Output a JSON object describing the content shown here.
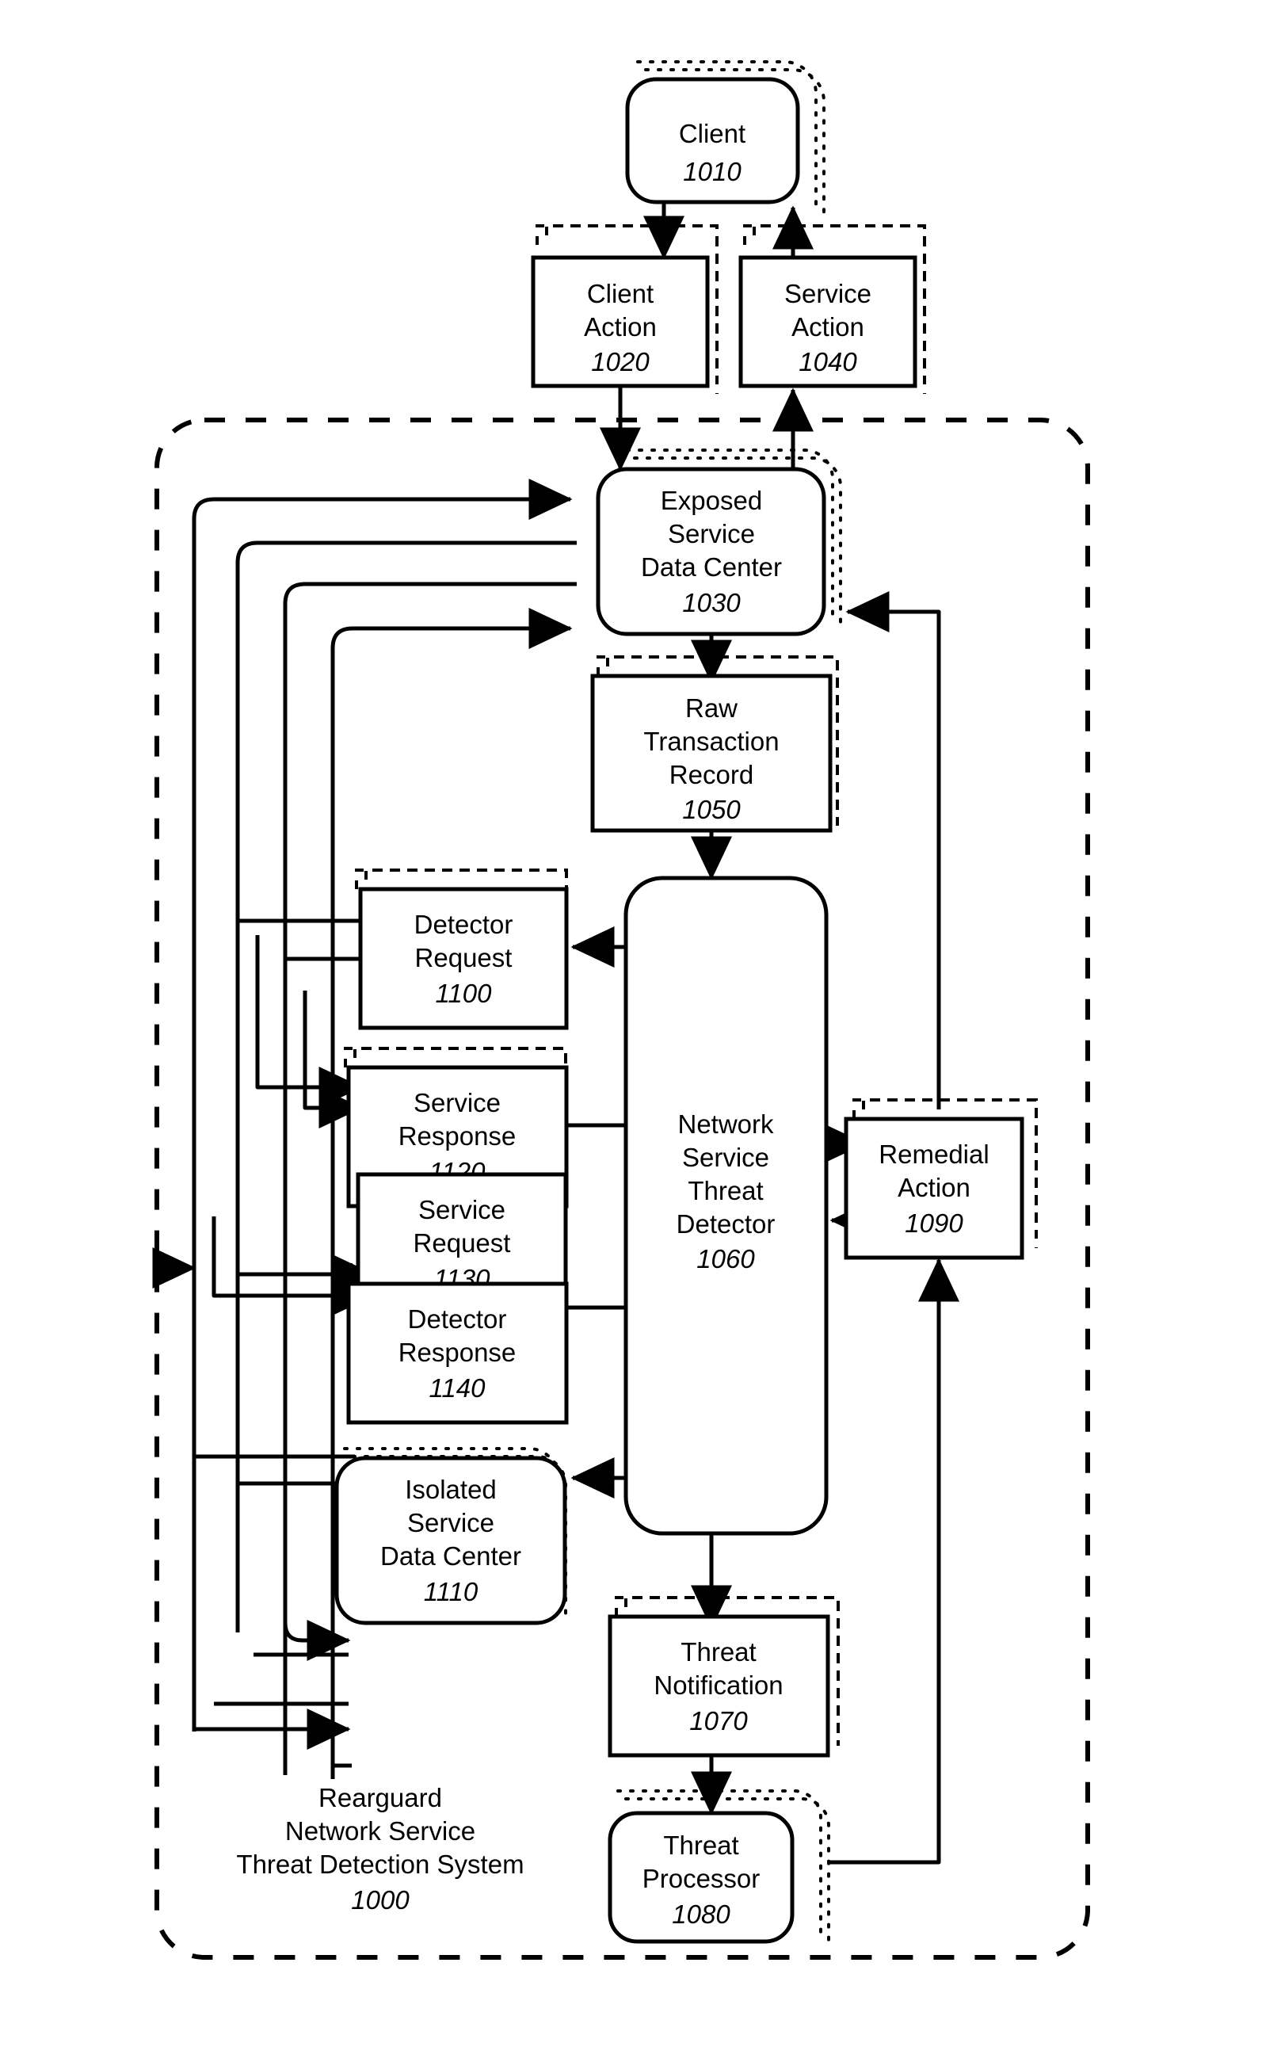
{
  "figure": {
    "title": "Rearguard Network Service Threat Detection System",
    "system_caption_lines": [
      "Rearguard",
      "Network Service",
      "Threat Detection System"
    ],
    "system_number": "1000",
    "boundary_style": "dashed-rounded"
  },
  "nodes": {
    "client": {
      "lines": [
        "Client"
      ],
      "number": "1010",
      "shape": "rounded",
      "stack": "dotted"
    },
    "client_action": {
      "lines": [
        "Client",
        "Action"
      ],
      "number": "1020",
      "shape": "rect",
      "stack": "dashed"
    },
    "service_action": {
      "lines": [
        "Service",
        "Action"
      ],
      "number": "1040",
      "shape": "rect",
      "stack": "dashed"
    },
    "exposed_dc": {
      "lines": [
        "Exposed",
        "Service",
        "Data Center"
      ],
      "number": "1030",
      "shape": "rounded",
      "stack": "dotted"
    },
    "raw_record": {
      "lines": [
        "Raw",
        "Transaction",
        "Record"
      ],
      "number": "1050",
      "shape": "rect",
      "stack": "dashed"
    },
    "detector_request": {
      "lines": [
        "Detector",
        "Request"
      ],
      "number": "1100",
      "shape": "rect",
      "stack": "dashed"
    },
    "service_response": {
      "lines": [
        "Service",
        "Response"
      ],
      "number": "1120",
      "shape": "rect",
      "stack": "dashed"
    },
    "service_request": {
      "lines": [
        "Service",
        "Request"
      ],
      "number": "1130",
      "shape": "rect",
      "stack": "dashed"
    },
    "detector_response": {
      "lines": [
        "Detector",
        "Response"
      ],
      "number": "1140",
      "shape": "rect",
      "stack": "dashed"
    },
    "isolated_dc": {
      "lines": [
        "Isolated",
        "Service",
        "Data Center"
      ],
      "number": "1110",
      "shape": "rounded",
      "stack": "dotted"
    },
    "detector": {
      "lines": [
        "Network",
        "Service",
        "Threat",
        "Detector"
      ],
      "number": "1060",
      "shape": "rounded",
      "stack": "none"
    },
    "remedial_action": {
      "lines": [
        "Remedial",
        "Action"
      ],
      "number": "1090",
      "shape": "rect",
      "stack": "dashed"
    },
    "threat_notification": {
      "lines": [
        "Threat",
        "Notification"
      ],
      "number": "1070",
      "shape": "rect",
      "stack": "dashed"
    },
    "threat_processor": {
      "lines": [
        "Threat",
        "Processor"
      ],
      "number": "1080",
      "shape": "rounded",
      "stack": "dotted"
    }
  },
  "colors": {
    "ink": "#000000",
    "paper": "#ffffff"
  }
}
